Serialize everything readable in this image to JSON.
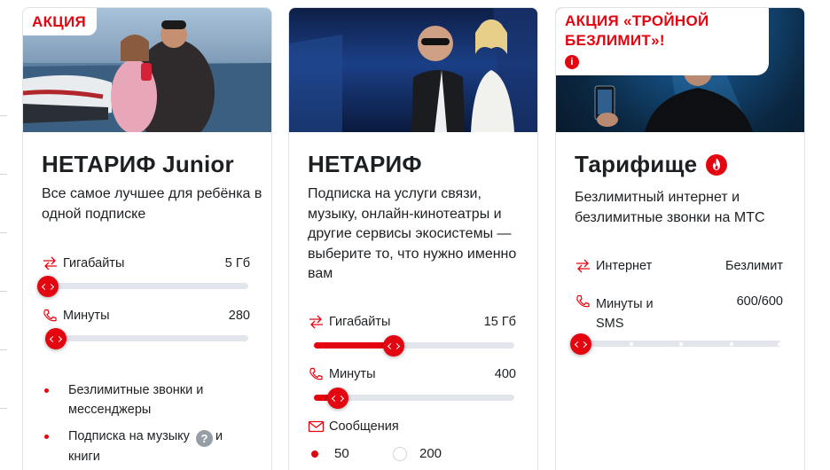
{
  "cards": [
    {
      "badge": "АКЦИЯ",
      "title": "НЕТАРИФ Junior",
      "description": "Все самое лучшее для ребёнка в одной подписке",
      "sliders": [
        {
          "label": "Гигабайты",
          "value": "5 Гб",
          "icon": "data-exchange-icon",
          "level": 0.0
        },
        {
          "label": "Минуты",
          "value": "280",
          "icon": "phone-icon",
          "level": 0.04
        }
      ],
      "features": [
        {
          "text": "Безлимитные звонки и мессенджеры"
        },
        {
          "text_before": "Подписка на музыку",
          "help": "?",
          "text_after": "и",
          "text_line2": "книги"
        }
      ]
    },
    {
      "title": "НЕТАРИФ",
      "description": "Подписка на услуги связи, музыку, онлайн-кинотеатры и другие сервисы экосистемы — выберите то, что нужно именно вам",
      "sliders": [
        {
          "label": "Гигабайты",
          "value": "15 Гб",
          "icon": "data-exchange-icon",
          "level": 0.4
        },
        {
          "label": "Минуты",
          "value": "400",
          "icon": "phone-icon",
          "level": 0.12
        }
      ],
      "messages": {
        "label": "Сообщения",
        "icon": "envelope-icon",
        "options": [
          "50",
          "200"
        ],
        "selected": "50"
      }
    },
    {
      "badge_line1": "АКЦИЯ «ТРОЙНОЙ",
      "badge_line2": "БЕЗЛИМИТ»!",
      "info": "i",
      "title": "Тарифище",
      "description": "Безлимитный интернет и безлимитные звонки на МТС",
      "rows": [
        {
          "label": "Интернет",
          "value": "Безлимит",
          "icon": "data-exchange-icon"
        },
        {
          "label_line1": "Минуты и",
          "label_line2": "SMS",
          "value": "600/600",
          "icon": "phone-icon",
          "level": 0.0
        }
      ]
    }
  ],
  "colors": {
    "accent": "#e30611",
    "text": "#1d2023",
    "track": "#e2e5eb",
    "help_icon": "#969fa8"
  }
}
